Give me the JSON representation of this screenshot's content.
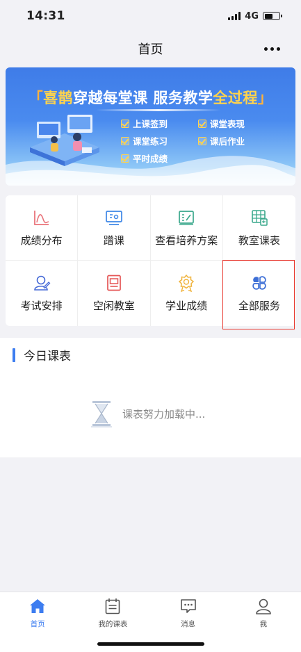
{
  "status_bar": {
    "time": "14:31",
    "network": "4G"
  },
  "nav": {
    "title": "首页",
    "more_icon": "more-dots-icon"
  },
  "banner": {
    "title_open": "「",
    "title_brand": "喜鹊",
    "title_mid": "穿越每堂课 服务教学",
    "title_emph": "全过程",
    "title_close": "」",
    "features": [
      "上课签到",
      "课堂表现",
      "课堂练习",
      "课后作业",
      "平时成绩"
    ]
  },
  "menu": {
    "items": [
      {
        "label": "成绩分布",
        "icon": "grade-distribution-icon",
        "color": "#e9737a"
      },
      {
        "label": "蹭课",
        "icon": "audit-class-icon",
        "color": "#3d86e6"
      },
      {
        "label": "查看培养方案",
        "icon": "training-plan-icon",
        "color": "#3aa88c"
      },
      {
        "label": "教室课表",
        "icon": "classroom-schedule-icon",
        "color": "#3aa88c"
      },
      {
        "label": "考试安排",
        "icon": "exam-schedule-icon",
        "color": "#4468d6"
      },
      {
        "label": "空闲教室",
        "icon": "free-classroom-icon",
        "color": "#e55555"
      },
      {
        "label": "学业成绩",
        "icon": "academic-score-icon",
        "color": "#f0b33c"
      },
      {
        "label": "全部服务",
        "icon": "all-services-icon",
        "color": "#3d6fd6"
      }
    ]
  },
  "today": {
    "title": "今日课表",
    "loading_text": "课表努力加载中..."
  },
  "tabbar": {
    "tabs": [
      {
        "label": "首页",
        "icon": "home-icon",
        "active": true
      },
      {
        "label": "我的课表",
        "icon": "schedule-icon",
        "active": false
      },
      {
        "label": "消息",
        "icon": "message-icon",
        "active": false
      },
      {
        "label": "我",
        "icon": "profile-icon",
        "active": false
      }
    ]
  },
  "colors": {
    "accent": "#3d7df0",
    "highlight_border": "#e8372d",
    "banner_blue": "#3f7ce8"
  }
}
